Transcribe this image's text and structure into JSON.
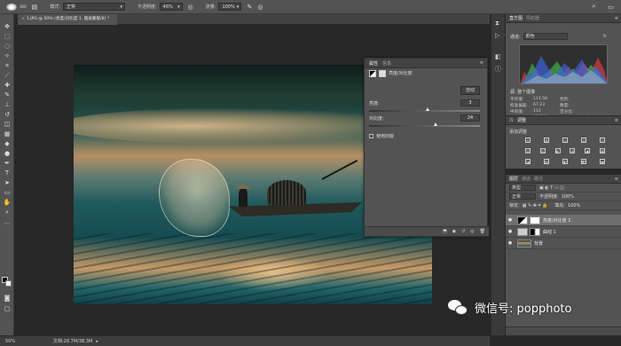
{
  "options_bar": {
    "brush_size": "300",
    "mode_label": "模式:",
    "mode_value": "正常",
    "opacity_label": "不透明度:",
    "opacity_value": "46%",
    "flow_label": "流量:",
    "flow_value": "100%"
  },
  "document_tab": {
    "title": "1.JPG @ 50% (亮度/对比度 1, 图层蒙版/8) *"
  },
  "properties_panel": {
    "tab_active": "属性",
    "tab_other": "信息",
    "adjustment_name": "亮度/对比度",
    "auto_button": "自动",
    "brightness_label": "亮度:",
    "brightness_value": "3",
    "brightness_level": 0.51,
    "contrast_label": "对比度:",
    "contrast_value": "24",
    "contrast_level": 0.58,
    "legacy_label": "使用旧版"
  },
  "histogram_panel": {
    "tab_active": "直方图",
    "tab_other": "导航器",
    "channel_label": "通道:",
    "channel_value": "颜色",
    "source_label": "源:",
    "source_value": "整个图像",
    "stats": [
      {
        "label": "平均值:",
        "value": "114.58",
        "label2": "色阶:",
        "value2": ""
      },
      {
        "label": "标准偏差:",
        "value": "67.23",
        "label2": "数量:",
        "value2": ""
      },
      {
        "label": "中间值:",
        "value": "112",
        "label2": "百分位:",
        "value2": ""
      },
      {
        "label": "像素:",
        "value": "156816",
        "label2": "高速缓存级别:",
        "value2": "4"
      }
    ]
  },
  "adjustments_panel": {
    "tab_other": "库",
    "tab_active": "调整",
    "add_label": "添加调整"
  },
  "layers_panel": {
    "tab_active": "图层",
    "tab_channels": "通道",
    "tab_paths": "路径",
    "kind_value": "类型",
    "blend_value": "正常",
    "opacity_label": "不透明度:",
    "opacity_value": "100%",
    "lock_label": "锁定:",
    "fill_label": "填充:",
    "fill_value": "100%",
    "layers": [
      {
        "name": "亮度/对比度 1"
      },
      {
        "name": "曲线 1"
      },
      {
        "name": "背景"
      }
    ]
  },
  "status_bar": {
    "zoom": "50%",
    "doc_info": "文档:28.7M/38.3M"
  },
  "watermark": {
    "text": "微信号: popphoto"
  },
  "colors": {
    "panel": "#535353",
    "canvas": "#282828",
    "selected_layer": "#6f6f6f"
  }
}
